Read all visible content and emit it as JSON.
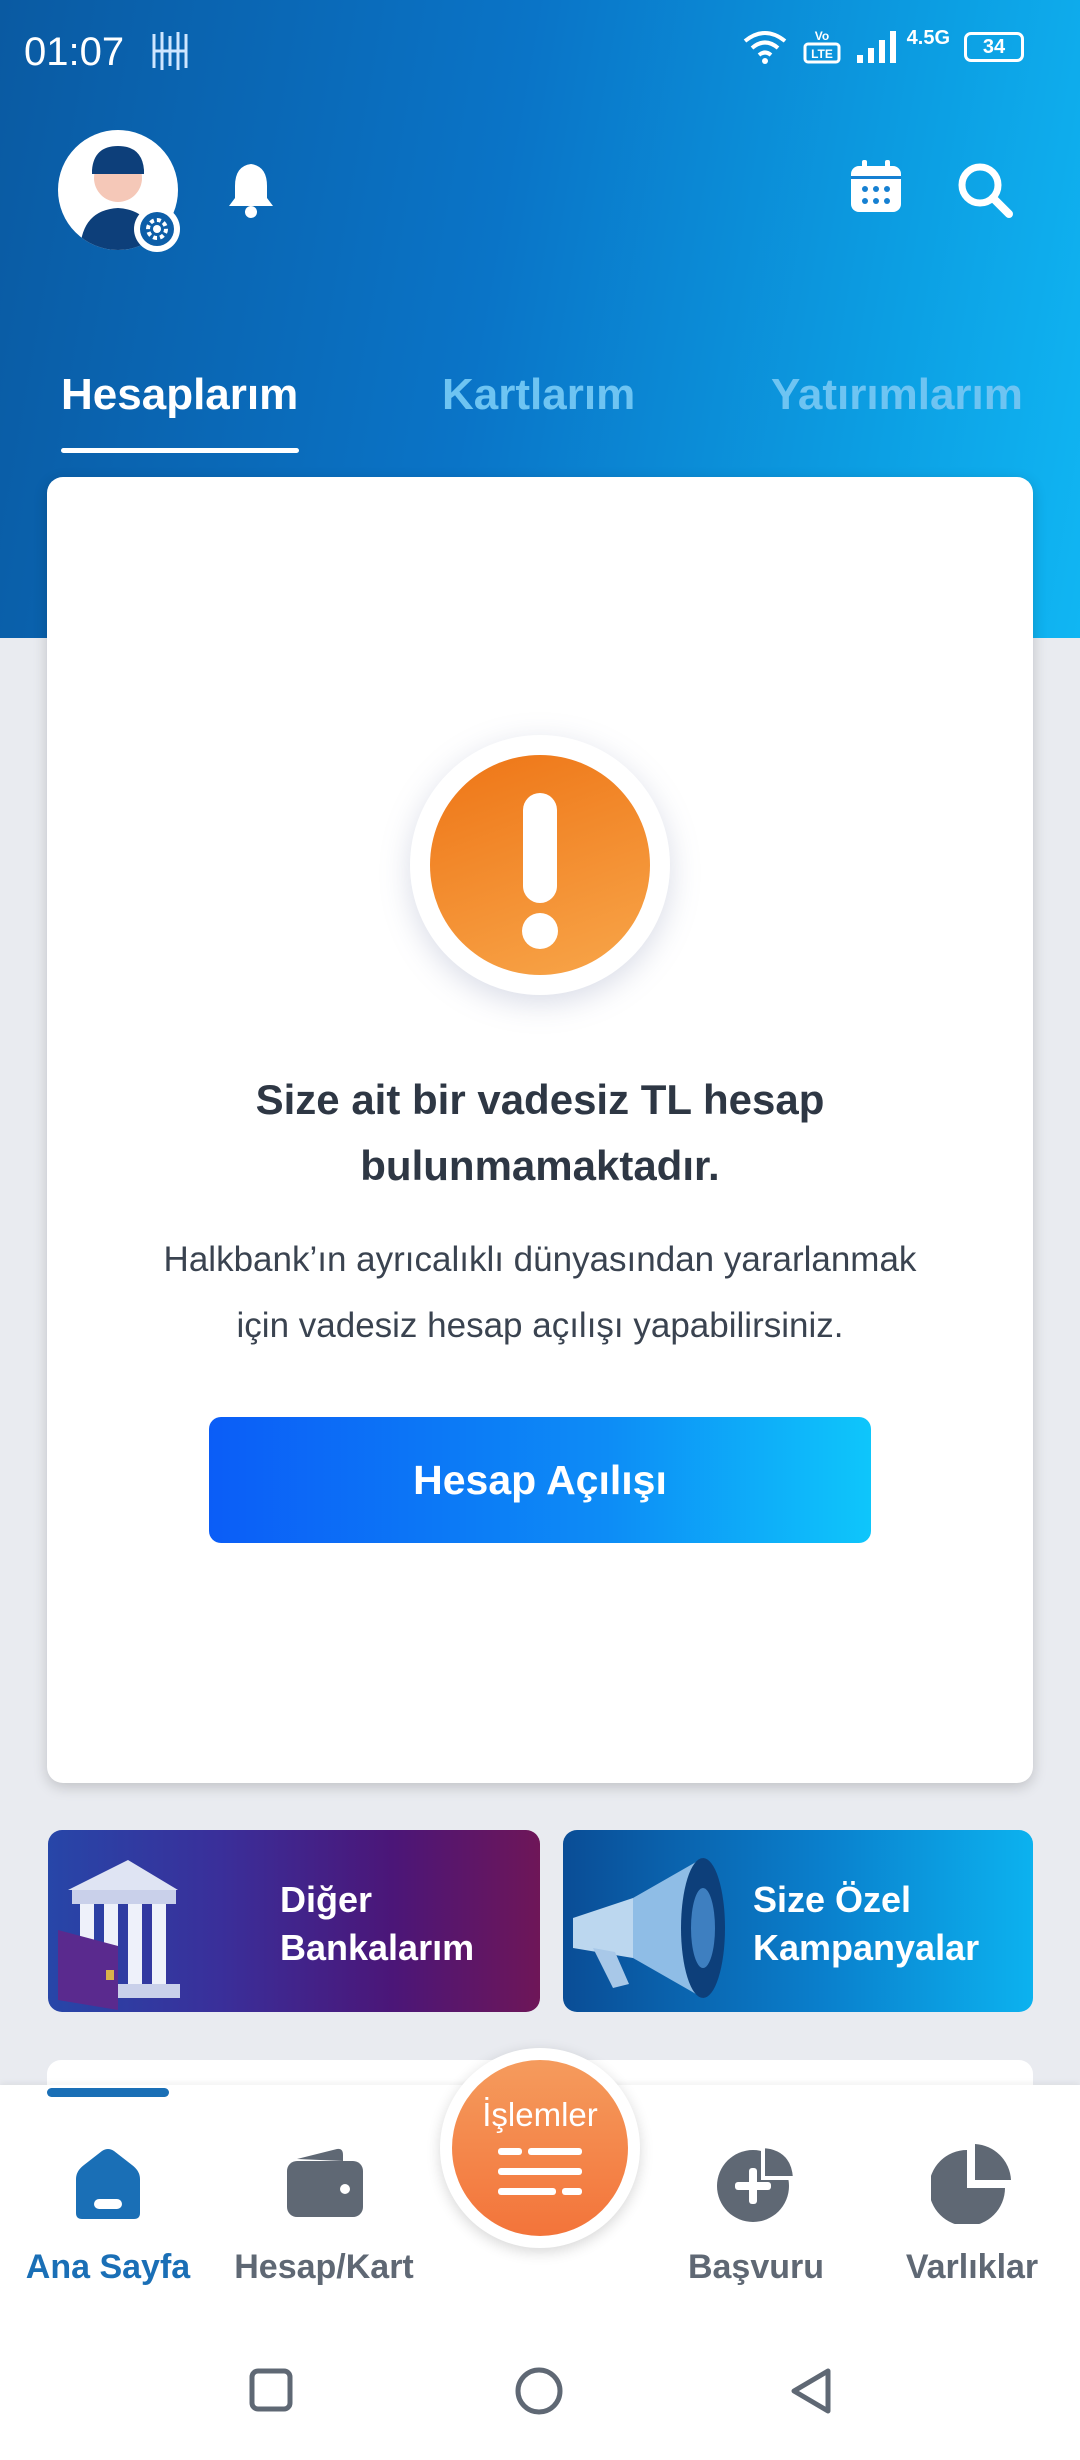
{
  "status_bar": {
    "time": "01:07",
    "network": "4.5G",
    "battery": "34"
  },
  "header": {
    "icons": [
      "account-icon",
      "settings-gear-icon",
      "bell-icon",
      "calendar-icon",
      "search-icon"
    ]
  },
  "tabs": [
    {
      "label": "Hesaplarım",
      "active": true
    },
    {
      "label": "Kartlarım",
      "active": false
    },
    {
      "label": "Yatırımlarım",
      "active": false
    }
  ],
  "account_card": {
    "title_line1": "Size ait bir vadesiz TL hesap",
    "title_line2": "bulunmamaktadır.",
    "desc_line1": "Halkbank’ın ayrıcalıklı dünyasından yararlanmak",
    "desc_line2": "için vadesiz hesap açılışı yapabilirsiniz.",
    "button_label": "Hesap Açılışı"
  },
  "promos": {
    "other_banks": {
      "line1": "Diğer",
      "line2": "Bankalarım"
    },
    "campaigns": {
      "line1": "Size Özel",
      "line2": "Kampanyalar"
    }
  },
  "bottom_nav": {
    "home": "Ana Sayfa",
    "account_card": "Hesap/Kart",
    "transactions": "İşlemler",
    "application": "Başvuru",
    "assets": "Varlıklar"
  },
  "colors": {
    "header_start": "#0a5aa2",
    "header_end": "#10b6f3",
    "accent": "#1a6fb6",
    "warning": "#f08a2c",
    "fab": "#f3743a"
  }
}
